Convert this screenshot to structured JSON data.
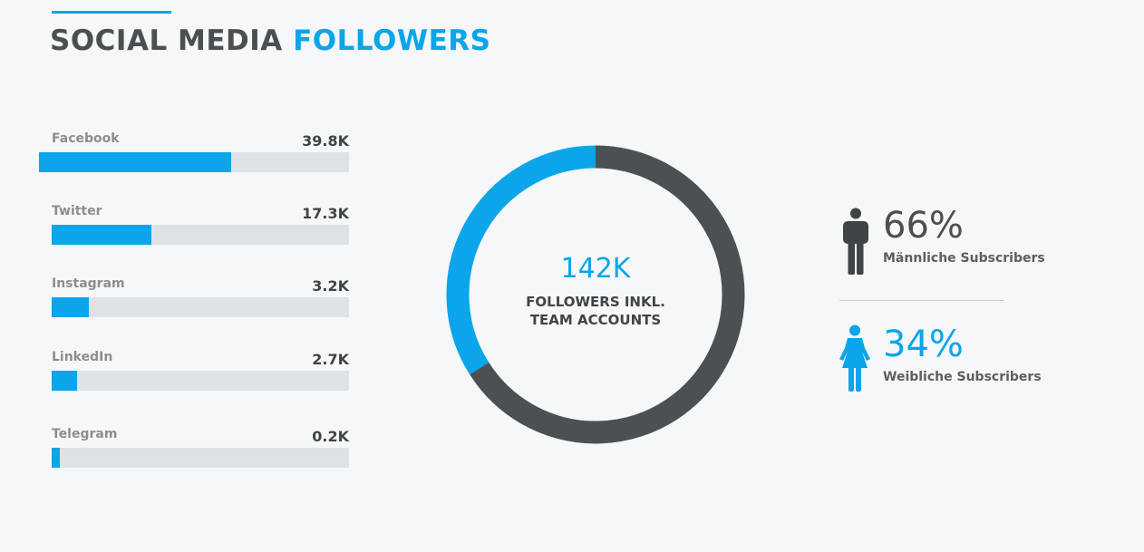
{
  "title": {
    "main": "SOCIAL MEDIA",
    "accent": "FOLLOWERS"
  },
  "colors": {
    "accent": "#0aa5ea",
    "dark": "#4a4f52",
    "track": "#dde2e6",
    "donut_dark": "#4b5153"
  },
  "chart_data": [
    {
      "type": "bar",
      "orientation": "horizontal",
      "categories": [
        "Facebook",
        "Twitter",
        "Instagram",
        "LinkedIn",
        "Telegram"
      ],
      "values": [
        39.8,
        17.3,
        3.2,
        2.7,
        0.2
      ],
      "value_labels": [
        "39.8K",
        "17.3K",
        "3.2K",
        "2.7K",
        "0.2K"
      ],
      "fill_fraction": [
        0.62,
        0.335,
        0.125,
        0.085,
        0.028
      ]
    },
    {
      "type": "pie",
      "style": "donut",
      "total_label": "142K",
      "caption": [
        "FOLLOWERS INKL.",
        "TEAM ACCOUNTS"
      ],
      "segments": [
        {
          "value": 66,
          "color": "#4b5153"
        },
        {
          "value": 34,
          "color": "#0aa5ea"
        }
      ]
    }
  ],
  "gender": {
    "male": {
      "percent": "66%",
      "label": "Männliche Subscribers",
      "icon": "male-person-icon"
    },
    "female": {
      "percent": "34%",
      "label": "Weibliche Subscribers",
      "icon": "female-person-icon"
    }
  }
}
